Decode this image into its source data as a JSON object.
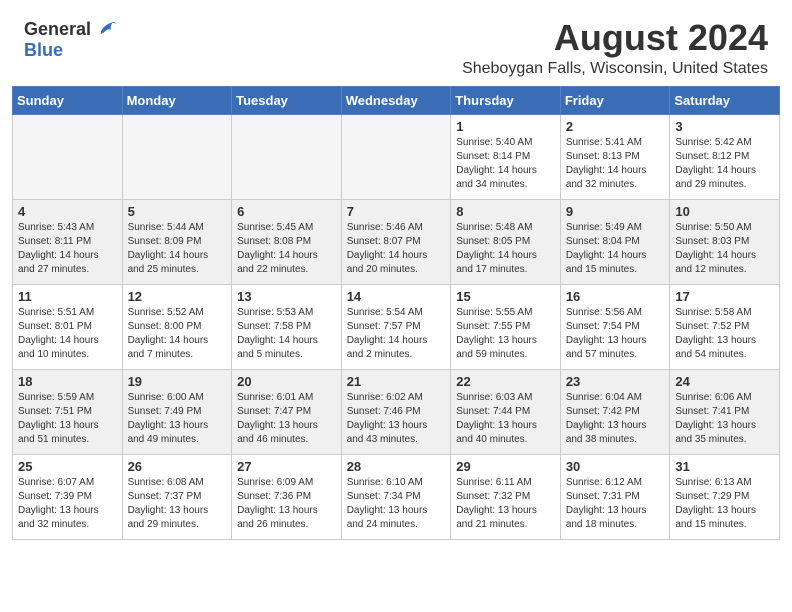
{
  "header": {
    "logo_general": "General",
    "logo_blue": "Blue",
    "title": "August 2024",
    "subtitle": "Sheboygan Falls, Wisconsin, United States"
  },
  "calendar": {
    "days_of_week": [
      "Sunday",
      "Monday",
      "Tuesday",
      "Wednesday",
      "Thursday",
      "Friday",
      "Saturday"
    ],
    "weeks": [
      {
        "shaded": false,
        "days": [
          {
            "num": "",
            "info": ""
          },
          {
            "num": "",
            "info": ""
          },
          {
            "num": "",
            "info": ""
          },
          {
            "num": "",
            "info": ""
          },
          {
            "num": "1",
            "info": "Sunrise: 5:40 AM\nSunset: 8:14 PM\nDaylight: 14 hours\nand 34 minutes."
          },
          {
            "num": "2",
            "info": "Sunrise: 5:41 AM\nSunset: 8:13 PM\nDaylight: 14 hours\nand 32 minutes."
          },
          {
            "num": "3",
            "info": "Sunrise: 5:42 AM\nSunset: 8:12 PM\nDaylight: 14 hours\nand 29 minutes."
          }
        ]
      },
      {
        "shaded": true,
        "days": [
          {
            "num": "4",
            "info": "Sunrise: 5:43 AM\nSunset: 8:11 PM\nDaylight: 14 hours\nand 27 minutes."
          },
          {
            "num": "5",
            "info": "Sunrise: 5:44 AM\nSunset: 8:09 PM\nDaylight: 14 hours\nand 25 minutes."
          },
          {
            "num": "6",
            "info": "Sunrise: 5:45 AM\nSunset: 8:08 PM\nDaylight: 14 hours\nand 22 minutes."
          },
          {
            "num": "7",
            "info": "Sunrise: 5:46 AM\nSunset: 8:07 PM\nDaylight: 14 hours\nand 20 minutes."
          },
          {
            "num": "8",
            "info": "Sunrise: 5:48 AM\nSunset: 8:05 PM\nDaylight: 14 hours\nand 17 minutes."
          },
          {
            "num": "9",
            "info": "Sunrise: 5:49 AM\nSunset: 8:04 PM\nDaylight: 14 hours\nand 15 minutes."
          },
          {
            "num": "10",
            "info": "Sunrise: 5:50 AM\nSunset: 8:03 PM\nDaylight: 14 hours\nand 12 minutes."
          }
        ]
      },
      {
        "shaded": false,
        "days": [
          {
            "num": "11",
            "info": "Sunrise: 5:51 AM\nSunset: 8:01 PM\nDaylight: 14 hours\nand 10 minutes."
          },
          {
            "num": "12",
            "info": "Sunrise: 5:52 AM\nSunset: 8:00 PM\nDaylight: 14 hours\nand 7 minutes."
          },
          {
            "num": "13",
            "info": "Sunrise: 5:53 AM\nSunset: 7:58 PM\nDaylight: 14 hours\nand 5 minutes."
          },
          {
            "num": "14",
            "info": "Sunrise: 5:54 AM\nSunset: 7:57 PM\nDaylight: 14 hours\nand 2 minutes."
          },
          {
            "num": "15",
            "info": "Sunrise: 5:55 AM\nSunset: 7:55 PM\nDaylight: 13 hours\nand 59 minutes."
          },
          {
            "num": "16",
            "info": "Sunrise: 5:56 AM\nSunset: 7:54 PM\nDaylight: 13 hours\nand 57 minutes."
          },
          {
            "num": "17",
            "info": "Sunrise: 5:58 AM\nSunset: 7:52 PM\nDaylight: 13 hours\nand 54 minutes."
          }
        ]
      },
      {
        "shaded": true,
        "days": [
          {
            "num": "18",
            "info": "Sunrise: 5:59 AM\nSunset: 7:51 PM\nDaylight: 13 hours\nand 51 minutes."
          },
          {
            "num": "19",
            "info": "Sunrise: 6:00 AM\nSunset: 7:49 PM\nDaylight: 13 hours\nand 49 minutes."
          },
          {
            "num": "20",
            "info": "Sunrise: 6:01 AM\nSunset: 7:47 PM\nDaylight: 13 hours\nand 46 minutes."
          },
          {
            "num": "21",
            "info": "Sunrise: 6:02 AM\nSunset: 7:46 PM\nDaylight: 13 hours\nand 43 minutes."
          },
          {
            "num": "22",
            "info": "Sunrise: 6:03 AM\nSunset: 7:44 PM\nDaylight: 13 hours\nand 40 minutes."
          },
          {
            "num": "23",
            "info": "Sunrise: 6:04 AM\nSunset: 7:42 PM\nDaylight: 13 hours\nand 38 minutes."
          },
          {
            "num": "24",
            "info": "Sunrise: 6:06 AM\nSunset: 7:41 PM\nDaylight: 13 hours\nand 35 minutes."
          }
        ]
      },
      {
        "shaded": false,
        "days": [
          {
            "num": "25",
            "info": "Sunrise: 6:07 AM\nSunset: 7:39 PM\nDaylight: 13 hours\nand 32 minutes."
          },
          {
            "num": "26",
            "info": "Sunrise: 6:08 AM\nSunset: 7:37 PM\nDaylight: 13 hours\nand 29 minutes."
          },
          {
            "num": "27",
            "info": "Sunrise: 6:09 AM\nSunset: 7:36 PM\nDaylight: 13 hours\nand 26 minutes."
          },
          {
            "num": "28",
            "info": "Sunrise: 6:10 AM\nSunset: 7:34 PM\nDaylight: 13 hours\nand 24 minutes."
          },
          {
            "num": "29",
            "info": "Sunrise: 6:11 AM\nSunset: 7:32 PM\nDaylight: 13 hours\nand 21 minutes."
          },
          {
            "num": "30",
            "info": "Sunrise: 6:12 AM\nSunset: 7:31 PM\nDaylight: 13 hours\nand 18 minutes."
          },
          {
            "num": "31",
            "info": "Sunrise: 6:13 AM\nSunset: 7:29 PM\nDaylight: 13 hours\nand 15 minutes."
          }
        ]
      }
    ]
  }
}
